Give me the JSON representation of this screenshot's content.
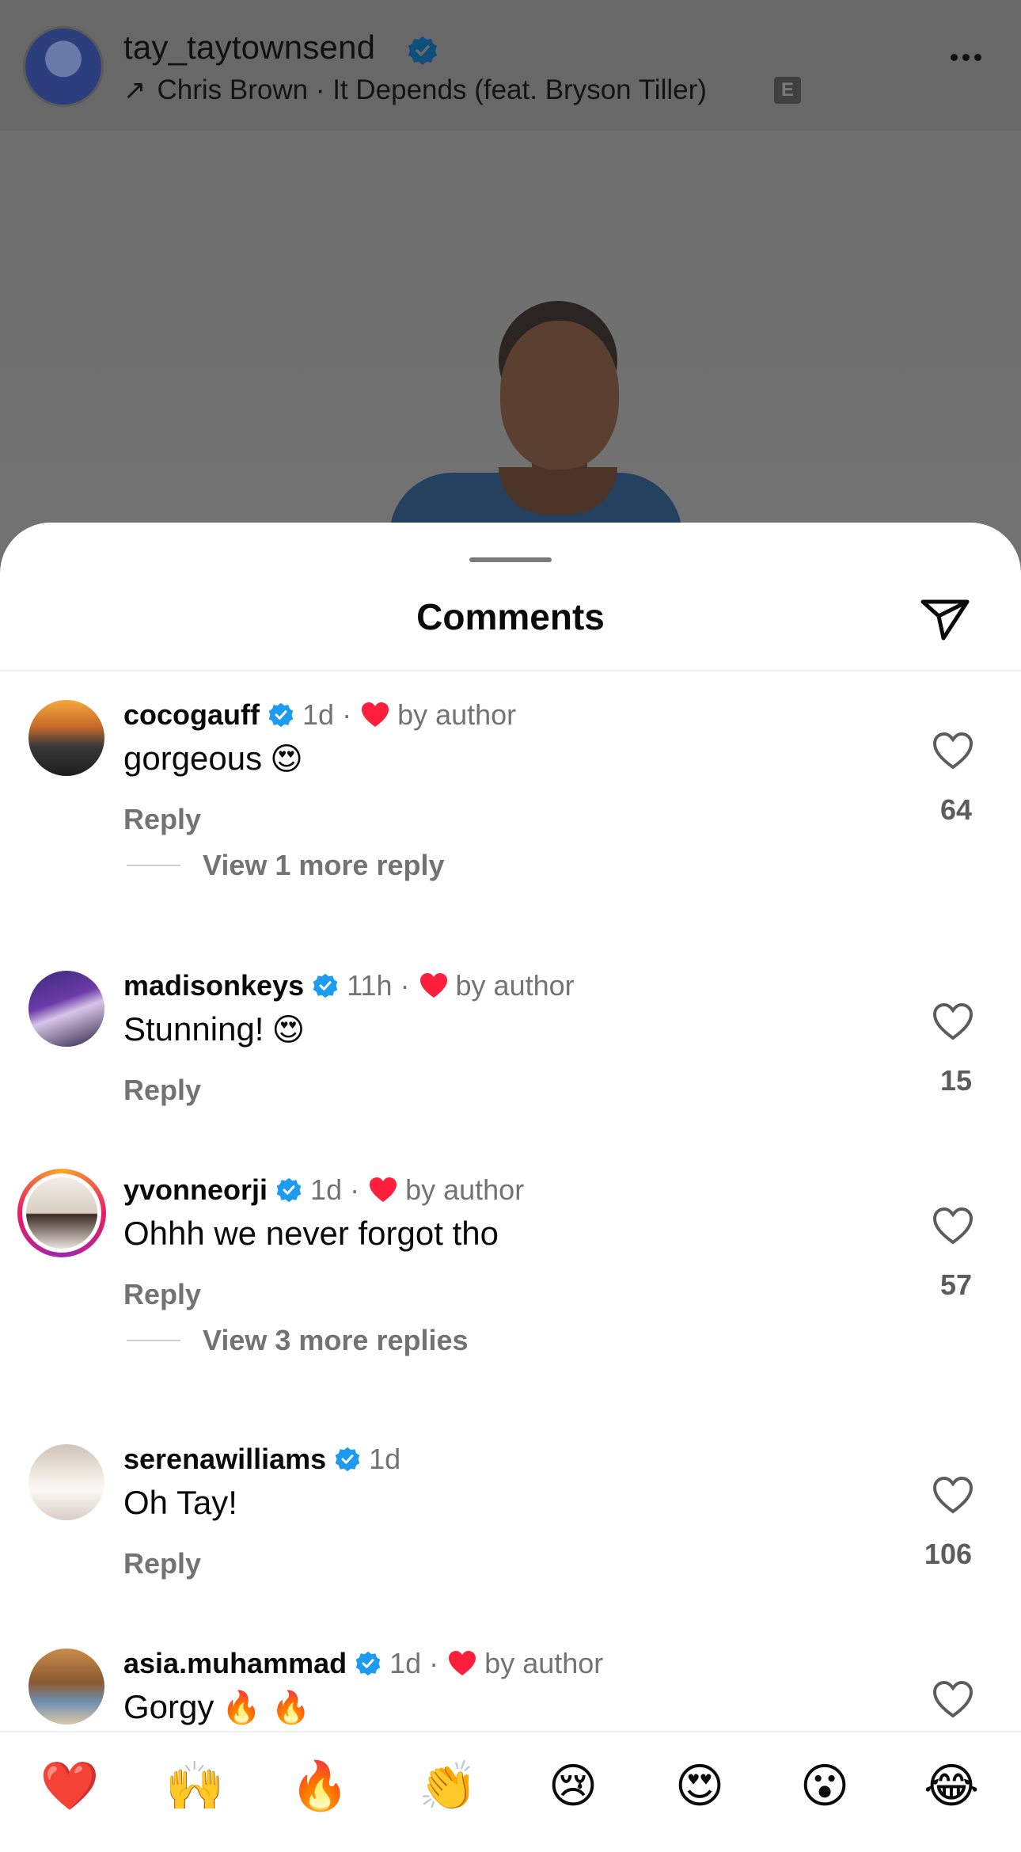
{
  "post": {
    "username": "tay_taytownsend",
    "audio": "Chris Brown · It Depends (feat. Bryson Tiller)",
    "explicit_badge": "E",
    "audio_arrow": "↗"
  },
  "sheet": {
    "title": "Comments"
  },
  "comments": [
    {
      "username": "cocogauff",
      "time": "1d",
      "dot": "·",
      "liked_by_author": "by author",
      "text": "gorgeous",
      "emoji": "😍",
      "reply_label": "Reply",
      "likes": "64",
      "view_more": "View 1 more reply"
    },
    {
      "username": "madisonkeys",
      "time": "11h",
      "dot": "·",
      "liked_by_author": "by author",
      "text": "Stunning!",
      "emoji": "😍",
      "reply_label": "Reply",
      "likes": "15"
    },
    {
      "username": "yvonneorji",
      "time": "1d",
      "dot": "·",
      "liked_by_author": "by author",
      "text": "Ohhh we never forgot tho",
      "reply_label": "Reply",
      "likes": "57",
      "view_more": "View 3 more replies"
    },
    {
      "username": "serenawilliams",
      "time": "1d",
      "text": "Oh Tay!",
      "reply_label": "Reply",
      "likes": "106"
    },
    {
      "username": "asia.muhammad",
      "time": "1d",
      "dot": "·",
      "liked_by_author": "by author",
      "text": "Gorgy",
      "emoji": "🔥 🔥"
    }
  ],
  "reactions": [
    "❤️",
    "🙌",
    "🔥",
    "👏",
    "😢",
    "😍",
    "😮",
    "😂"
  ],
  "colors": {
    "verified": "#1d9bf0",
    "heart": "#ff1e3c",
    "secondary_text": "#737373"
  }
}
